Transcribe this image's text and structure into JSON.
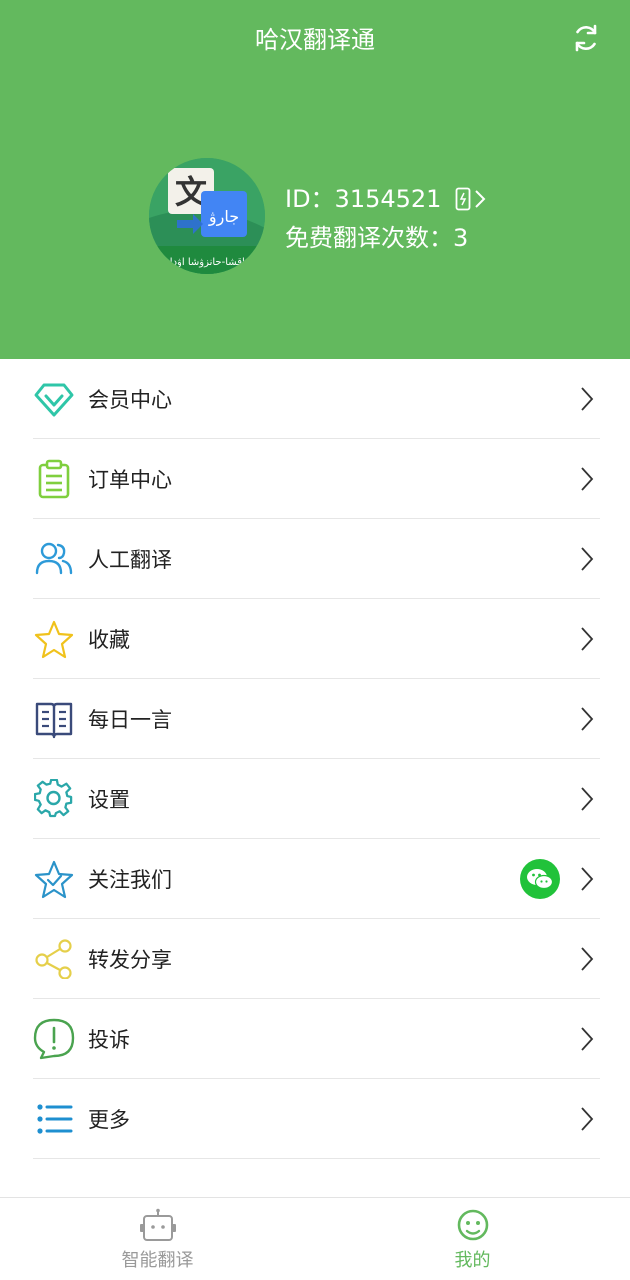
{
  "header": {
    "title": "哈汉翻译通",
    "user_id": "ID：3154521",
    "free_count": "免费翻译次数：3",
    "avatar_text_cn": "文",
    "avatar_text_kz": "جارۋ",
    "avatar_banner": "قازاقشا-حانزۋشا اۋدارما"
  },
  "colors": {
    "primary": "#63b95e",
    "wechat": "#21c23a"
  },
  "menu": {
    "items": [
      {
        "label": "会员中心",
        "icon": "diamond-icon"
      },
      {
        "label": "订单中心",
        "icon": "clipboard-icon"
      },
      {
        "label": "人工翻译",
        "icon": "users-icon"
      },
      {
        "label": "收藏",
        "icon": "star-icon"
      },
      {
        "label": "每日一言",
        "icon": "book-icon"
      },
      {
        "label": "设置",
        "icon": "gear-icon"
      },
      {
        "label": "关注我们",
        "icon": "star-check-icon"
      },
      {
        "label": "转发分享",
        "icon": "share-icon"
      },
      {
        "label": "投诉",
        "icon": "complaint-icon"
      },
      {
        "label": "更多",
        "icon": "list-icon"
      }
    ]
  },
  "tabs": [
    {
      "label": "智能翻译",
      "icon": "robot-icon",
      "active": false
    },
    {
      "label": "我的",
      "icon": "smile-icon",
      "active": true
    }
  ]
}
